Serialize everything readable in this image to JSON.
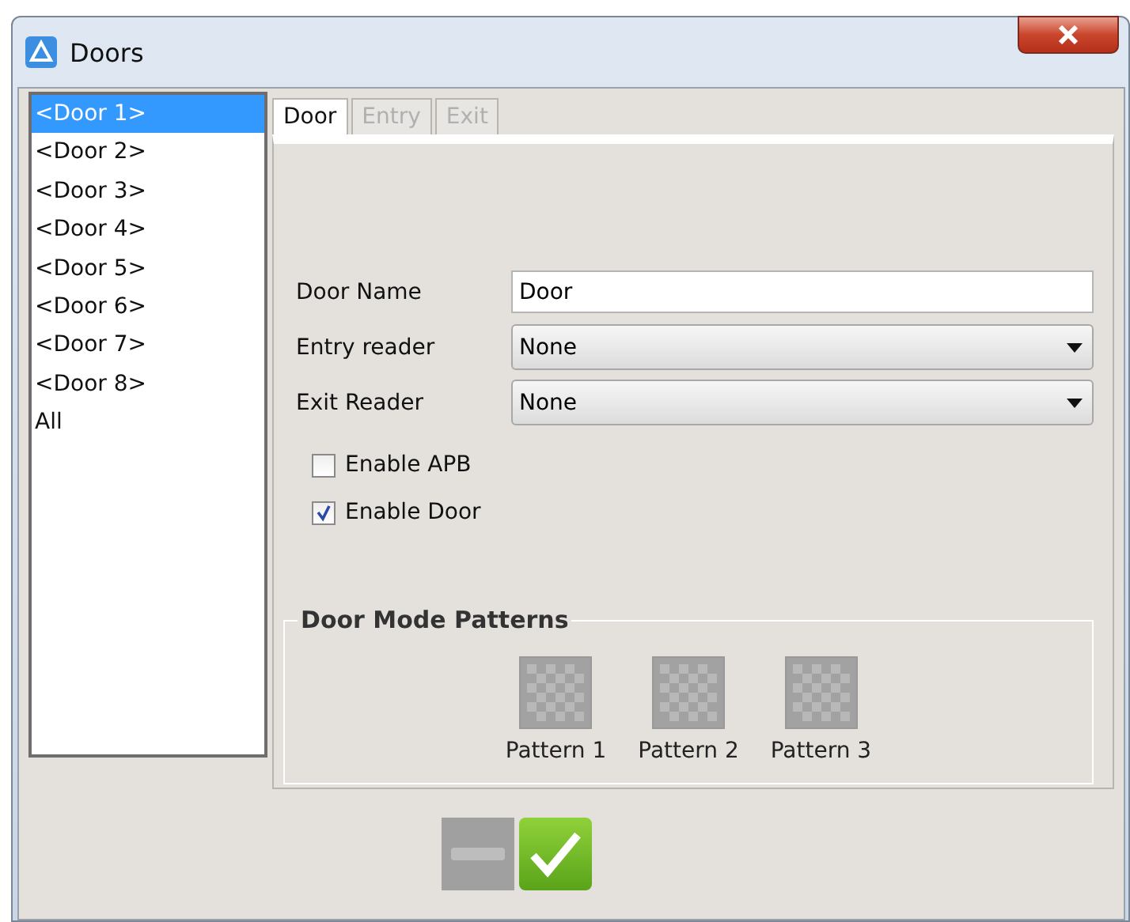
{
  "window": {
    "title": "Doors"
  },
  "doors": [
    {
      "label": "<Door 1>",
      "selected": true
    },
    {
      "label": "<Door 2>",
      "selected": false
    },
    {
      "label": "<Door 3>",
      "selected": false
    },
    {
      "label": "<Door 4>",
      "selected": false
    },
    {
      "label": "<Door 5>",
      "selected": false
    },
    {
      "label": "<Door 6>",
      "selected": false
    },
    {
      "label": "<Door 7>",
      "selected": false
    },
    {
      "label": "<Door 8>",
      "selected": false
    },
    {
      "label": "All",
      "selected": false
    }
  ],
  "tabs": [
    {
      "label": "Door",
      "selected": true,
      "disabled": false
    },
    {
      "label": "Entry",
      "selected": false,
      "disabled": true
    },
    {
      "label": "Exit",
      "selected": false,
      "disabled": true
    }
  ],
  "fields": [
    {
      "kind": "text",
      "label": "Door Name",
      "value": "Door"
    },
    {
      "kind": "select",
      "label": "Entry reader",
      "value": "None"
    },
    {
      "kind": "select",
      "label": "Exit Reader",
      "value": "None"
    }
  ],
  "checkboxes": [
    {
      "label": "Enable APB",
      "checked": false
    },
    {
      "label": "Enable Door",
      "checked": true
    }
  ],
  "patterns": {
    "title": "Door Mode Patterns",
    "items": [
      "Pattern 1",
      "Pattern 2",
      "Pattern 3"
    ]
  }
}
